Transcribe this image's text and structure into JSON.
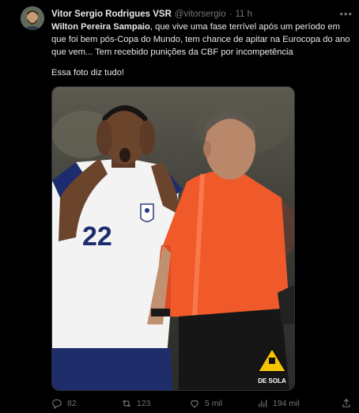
{
  "author": {
    "name": "Vitor Sergio Rodrigues VSR",
    "handle": "@vitorsergio",
    "separator": "·",
    "time": "11 h"
  },
  "tweet": {
    "bold_lead": "Wilton Pereira Sampaio",
    "body_rest": ", que vive uma fase terrível após um período em que foi bem pós-Copa do Mundo, tem chance de apitar na Eurocopa do ano que vem... Tem recebido punições da CBF por incompetência",
    "caption": "Essa foto diz tudo!"
  },
  "media": {
    "jersey_number": "22",
    "watermark": "DE SOLA"
  },
  "actions": {
    "replies": "82",
    "retweets": "123",
    "likes": "5 mil",
    "views": "194 mil"
  },
  "colors": {
    "background": "#000000",
    "text": "#e7e9ea",
    "muted": "#71767b",
    "referee_orange": "#f05a2a"
  }
}
